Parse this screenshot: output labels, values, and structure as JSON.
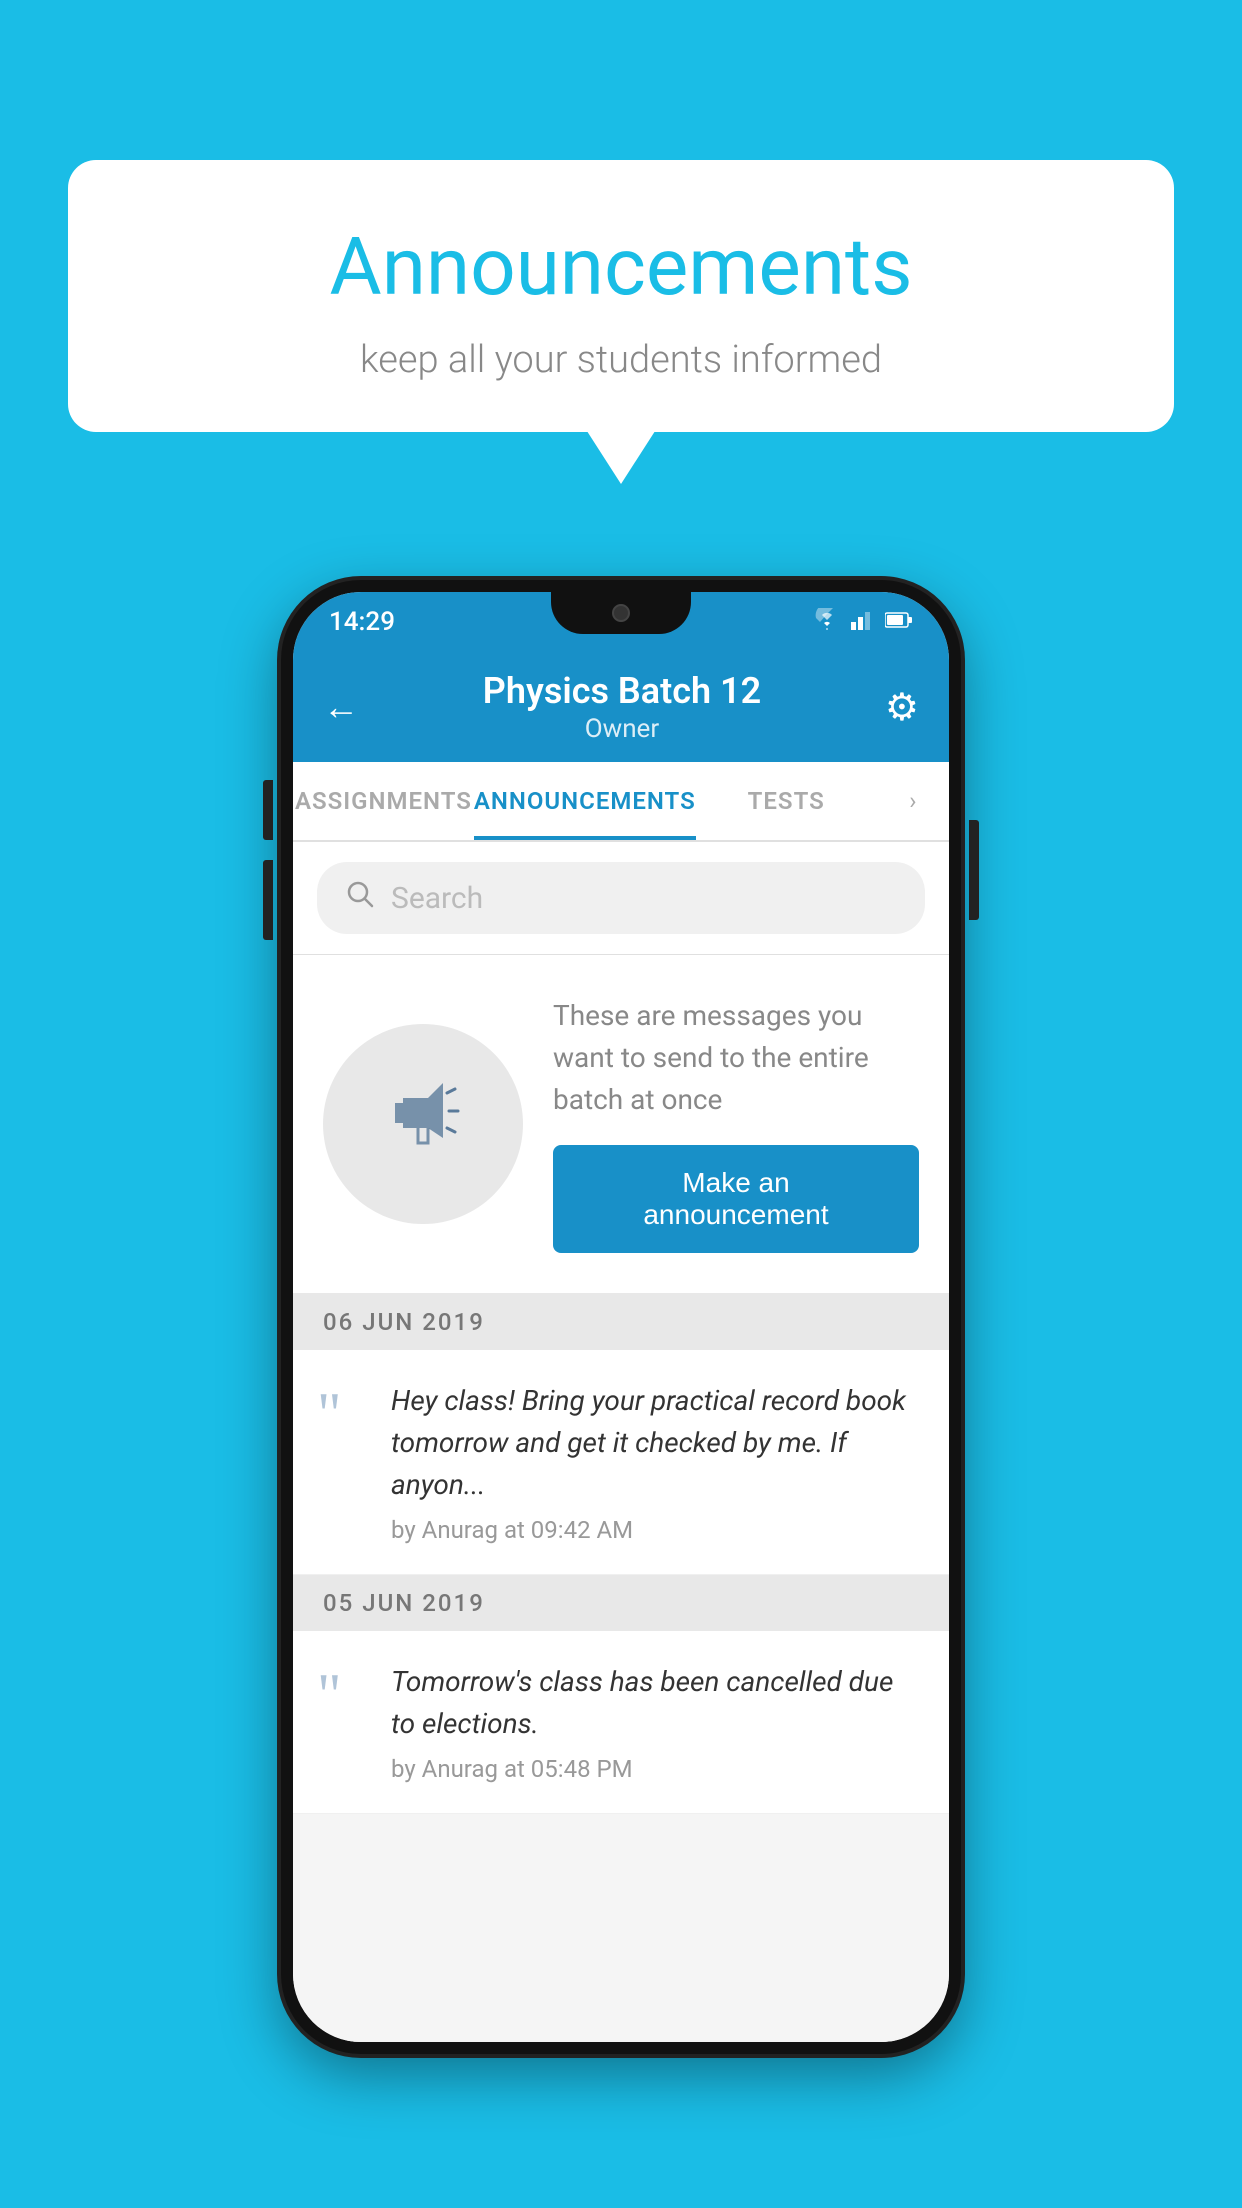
{
  "background_color": "#1ABDE6",
  "speech_bubble": {
    "title": "Announcements",
    "subtitle": "keep all your students informed"
  },
  "phone": {
    "status_bar": {
      "time": "14:29",
      "wifi": "▼",
      "signal": "▲",
      "battery": "▌"
    },
    "app_bar": {
      "back_label": "←",
      "title": "Physics Batch 12",
      "subtitle": "Owner",
      "gear_label": "⚙"
    },
    "tabs": [
      {
        "label": "ASSIGNMENTS",
        "active": false
      },
      {
        "label": "ANNOUNCEMENTS",
        "active": true
      },
      {
        "label": "TESTS",
        "active": false
      }
    ],
    "search": {
      "placeholder": "Search"
    },
    "empty_state": {
      "description": "These are messages you want to send to the entire batch at once",
      "button_label": "Make an announcement"
    },
    "announcements": [
      {
        "date": "06  JUN  2019",
        "text": "Hey class! Bring your practical record book tomorrow and get it checked by me. If anyon...",
        "meta": "by Anurag at 09:42 AM"
      },
      {
        "date": "05  JUN  2019",
        "text": "Tomorrow's class has been cancelled due to elections.",
        "meta": "by Anurag at 05:48 PM"
      }
    ]
  }
}
